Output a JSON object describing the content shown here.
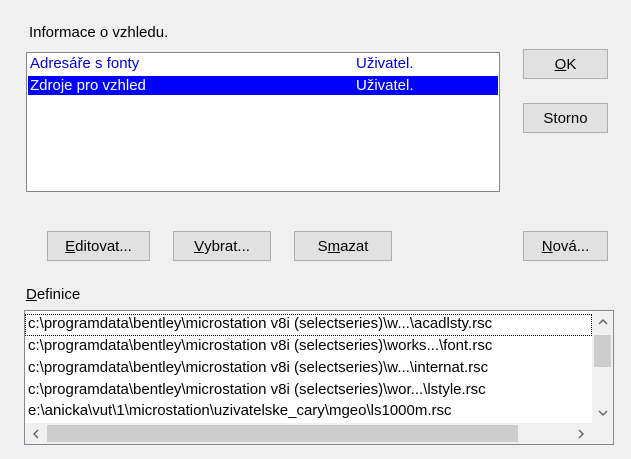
{
  "appearance_info": {
    "label": "Informace o vzhledu.",
    "rows": [
      {
        "name": "Adresáře s fonty",
        "type": "Uživatel."
      },
      {
        "name": "Zdroje pro vzhled",
        "type": "Uživatel."
      }
    ]
  },
  "buttons": {
    "ok": {
      "u": "O",
      "rest": "K"
    },
    "storno": "Storno",
    "editovat": {
      "u": "E",
      "rest": "ditovat..."
    },
    "vybrat": {
      "u": "V",
      "rest": "ybrat..."
    },
    "smazat": {
      "pre": "S",
      "u": "m",
      "rest": "azat"
    },
    "nova": {
      "u": "N",
      "rest": "ová..."
    }
  },
  "definitions": {
    "label": {
      "u": "D",
      "rest": "efinice"
    },
    "items": [
      "c:\\programdata\\bentley\\microstation v8i (selectseries)\\w...\\acadlsty.rsc",
      "c:\\programdata\\bentley\\microstation v8i (selectseries)\\works...\\font.rsc",
      "c:\\programdata\\bentley\\microstation v8i (selectseries)\\w...\\internat.rsc",
      "c:\\programdata\\bentley\\microstation v8i (selectseries)\\wor...\\lstyle.rsc",
      "e:\\anicka\\vut\\1\\microstation\\uzivatelske_cary\\mgeo\\ls1000m.rsc"
    ]
  },
  "colors": {
    "selection": "#0000ff",
    "item_text": "#0000cc"
  },
  "icons": [
    "scroll-up-arrow-icon",
    "scroll-down-arrow-icon",
    "scroll-left-arrow-icon",
    "scroll-right-arrow-icon"
  ]
}
